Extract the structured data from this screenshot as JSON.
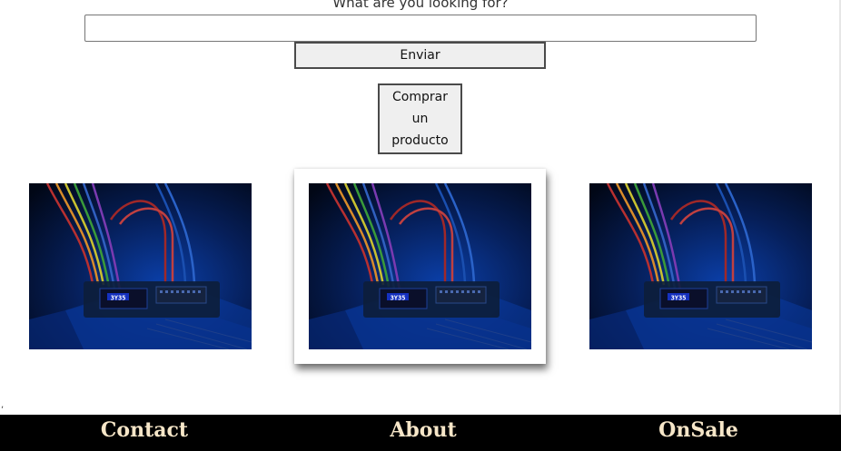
{
  "search": {
    "label": "What are you looking for?",
    "value": "",
    "placeholder": "",
    "submit_label": "Enviar"
  },
  "buy_button_label": "Comprar un producto",
  "gallery": {
    "images": [
      {
        "alt": "Breadboard with jumper wires and OLED display"
      },
      {
        "alt": "Breadboard with jumper wires and OLED display"
      },
      {
        "alt": "Breadboard with jumper wires and OLED display"
      }
    ],
    "display_text": "3Y35"
  },
  "stray_mark": ",",
  "footer": {
    "links": [
      "Contact",
      "About",
      "OnSale"
    ]
  },
  "colors": {
    "footer_bg": "#000000",
    "footer_text": "#f6e6c8",
    "button_bg": "#efefef"
  }
}
